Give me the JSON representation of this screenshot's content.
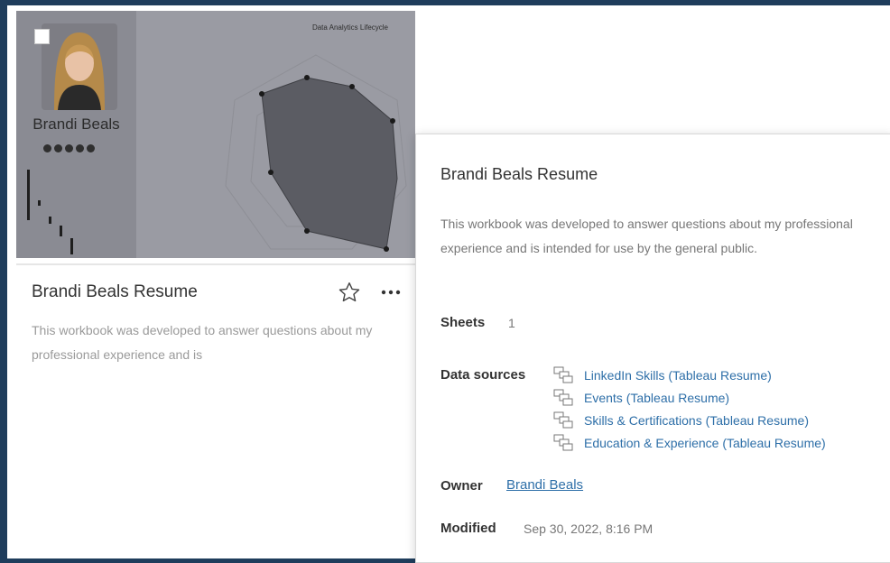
{
  "workbook": {
    "thumbnail": {
      "person_name": "Brandi Beals",
      "chart_title": "Data Analytics Lifecycle"
    },
    "card": {
      "title": "Brandi Beals Resume",
      "description": "This workbook was developed to answer questions about my professional experience and is",
      "favorite_icon": "star-outline-icon",
      "more_icon": "ellipsis-icon"
    }
  },
  "details_popover": {
    "title": "Brandi Beals Resume",
    "description": "This workbook was developed to answer questions about my professional experience and is intended for use by the general public.",
    "sheets_label": "Sheets",
    "sheets_value": "1",
    "data_sources_label": "Data sources",
    "data_sources": [
      {
        "name": "LinkedIn Skills (Tableau Resume)",
        "icon": "data-source-icon"
      },
      {
        "name": "Events (Tableau Resume)",
        "icon": "data-source-icon"
      },
      {
        "name": "Skills & Certifications (Tableau Resume)",
        "icon": "data-source-icon"
      },
      {
        "name": "Education & Experience (Tableau Resume)",
        "icon": "data-source-icon"
      }
    ],
    "owner_label": "Owner",
    "owner_value": "Brandi Beals",
    "modified_label": "Modified",
    "modified_value": "Sep 30, 2022, 8:16 PM"
  },
  "colors": {
    "frame_background": "#1f3d5c",
    "link": "#2e6fa8",
    "thumbnail_bg": "#9a9ba3",
    "radar_fill": "#5b5c63"
  }
}
